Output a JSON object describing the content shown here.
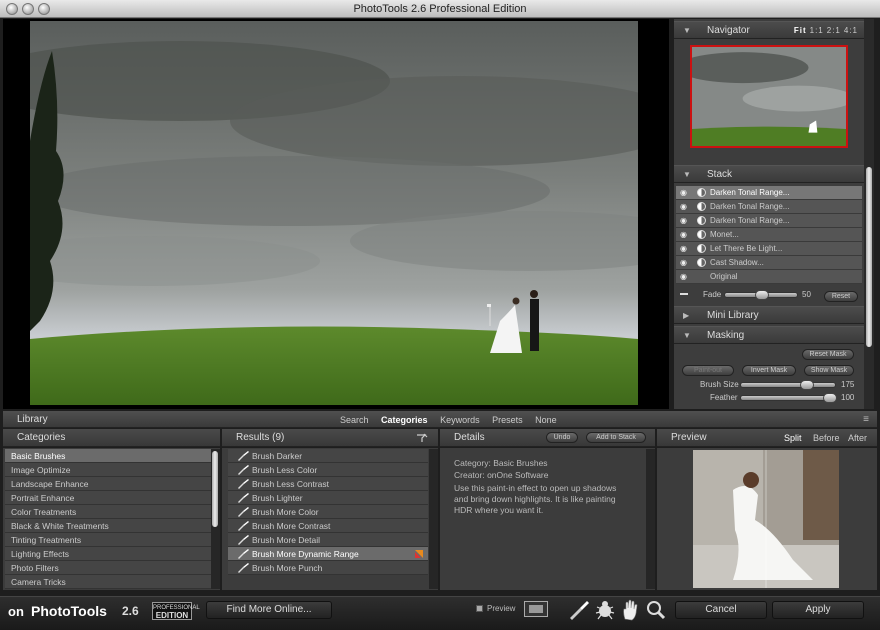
{
  "window": {
    "title": "PhotoTools 2.6 Professional Edition"
  },
  "navigator": {
    "title": "Navigator",
    "zoom": [
      "Fit",
      "1:1",
      "2:1",
      "4:1"
    ]
  },
  "stack": {
    "title": "Stack",
    "items": [
      "Darken Tonal Range...",
      "Darken Tonal Range...",
      "Darken Tonal Range...",
      "Monet...",
      "Let There Be Light...",
      "Cast Shadow...",
      "Original"
    ],
    "fade_label": "Fade",
    "fade_value": "50",
    "fade_fraction": 0.5,
    "reset_label": "Reset"
  },
  "mini_library": {
    "title": "Mini Library"
  },
  "masking": {
    "title": "Masking",
    "reset_mask": "Reset Mask",
    "paint_out": "Paint-out",
    "invert_mask": "Invert Mask",
    "show_mask": "Show Mask",
    "brush_size_label": "Brush Size",
    "brush_size_value": "175",
    "brush_size_fraction": 0.72,
    "feather_label": "Feather",
    "feather_value": "100",
    "feather_fraction": 1.0
  },
  "library": {
    "title": "Library",
    "tabs": [
      "Search",
      "Categories",
      "Keywords",
      "Presets",
      "None"
    ],
    "active_tab": "Categories"
  },
  "categories": {
    "title": "Categories",
    "items": [
      "Basic Brushes",
      "Image Optimize",
      "Landscape Enhance",
      "Portrait Enhance",
      "Color Treatments",
      "Black & White Treatments",
      "Tinting Treatments",
      "Lighting Effects",
      "Photo Filters",
      "Camera Tricks"
    ]
  },
  "results": {
    "title": "Results (9)",
    "items": [
      "Brush Darker",
      "Brush Less Color",
      "Brush Less Contrast",
      "Brush Lighter",
      "Brush More Color",
      "Brush More Contrast",
      "Brush More Detail",
      "Brush More Dynamic Range",
      "Brush More Punch"
    ]
  },
  "details": {
    "title": "Details",
    "undo": "Undo",
    "add_to_stack": "Add to Stack",
    "category": "Category:  Basic Brushes",
    "creator": "Creator:    onOne Software",
    "description_lines": [
      "Use this paint-in effect to open up shadows",
      "and bring down highlights. It is like painting",
      "HDR where you want it."
    ]
  },
  "preview": {
    "title": "Preview",
    "modes": [
      "Split",
      "Before",
      "After"
    ]
  },
  "bottom": {
    "logo_on": "on",
    "logo_text": "PhotoTools",
    "version": "2.6",
    "edition_badge_line1": "PROFESSIONAL",
    "edition_badge_line2": "EDITION",
    "find_more": "Find More Online...",
    "preview_label": "Preview",
    "cancel": "Cancel",
    "apply": "Apply"
  }
}
